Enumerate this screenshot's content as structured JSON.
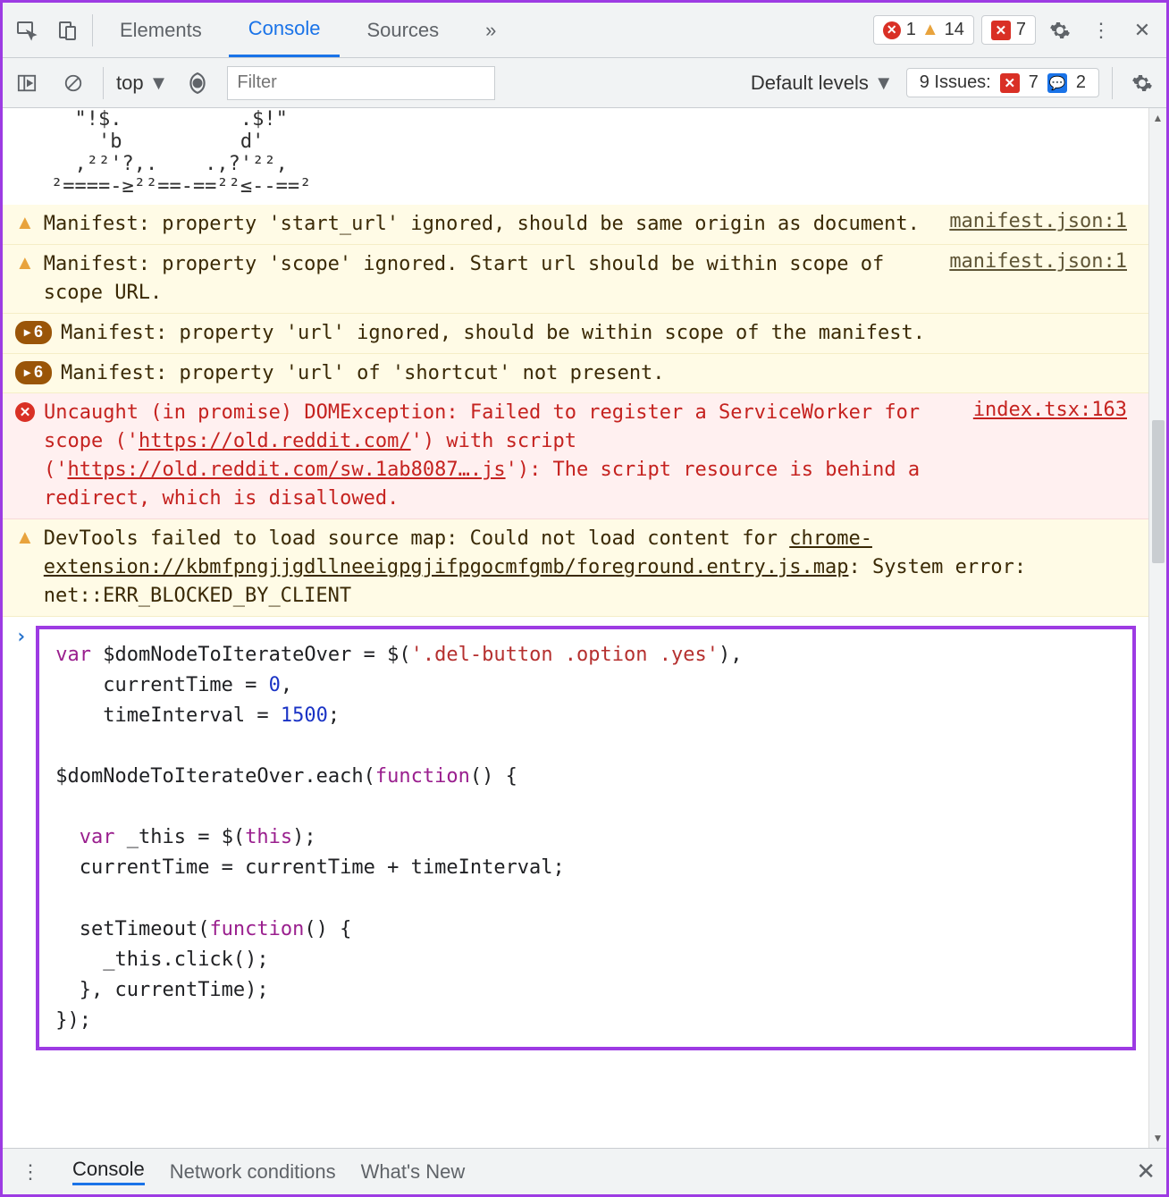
{
  "tabs": {
    "elements": "Elements",
    "console": "Console",
    "sources": "Sources"
  },
  "topStatus": {
    "errors": "1",
    "warnings": "14",
    "chat": "7"
  },
  "toolbar": {
    "context": "top",
    "filterPlaceholder": "Filter",
    "levelsLabel": "Default levels",
    "issuesLabel": "9 Issues:",
    "issuesRed": "7",
    "issuesBlue": "2"
  },
  "ascii": "  \"!$.          .$!\"\n    'b          d'\n  ,²²'?,.    .,?'²²,\n²====-≥²²==-==²²≤--==²",
  "messages": [
    {
      "type": "warn",
      "text": "Manifest: property 'start_url' ignored, should be same origin as document.",
      "link": "manifest.json:1"
    },
    {
      "type": "warn",
      "text": "Manifest: property 'scope' ignored. Start url should be within scope of scope URL.",
      "link": "manifest.json:1"
    },
    {
      "type": "warn-count",
      "count": "6",
      "text": "Manifest: property 'url' ignored, should be within scope of the manifest."
    },
    {
      "type": "warn-count",
      "count": "6",
      "text": "Manifest: property 'url' of 'shortcut' not present."
    },
    {
      "type": "err",
      "pre": "Uncaught (in promise) DOMException: Failed to register a ServiceWorker for scope ('",
      "url1": "https://old.reddit.com/",
      "mid": "') with script ('",
      "url2": "https://old.reddit.com/sw.1ab8087….js",
      "post": "'): The script resource is behind a redirect, which is disallowed.",
      "link": "index.tsx:163"
    },
    {
      "type": "warn",
      "pre": "DevTools failed to load source map: Could not load content for ",
      "url1": "chrome-extension://kbmfpngjjgdllneeigpgjifpgocmfgmb/foreground.entry.js.map",
      "post": ": System error: net::ERR_BLOCKED_BY_CLIENT"
    }
  ],
  "code": {
    "l1a": "var",
    "l1b": " $domNodeToIterateOver = $(",
    "l1c": "'.del-button .option .yes'",
    "l1d": "),",
    "l2a": "    currentTime = ",
    "l2b": "0",
    "l2c": ",",
    "l3a": "    timeInterval = ",
    "l3b": "1500",
    "l3c": ";",
    "l4": "",
    "l5a": "$domNodeToIterateOver.each(",
    "l5b": "function",
    "l5c": "() {",
    "l6": "",
    "l7a": "  var",
    "l7b": " _this = $(",
    "l7c": "this",
    "l7d": ");",
    "l8": "  currentTime = currentTime + timeInterval;",
    "l9": "",
    "l10a": "  setTimeout(",
    "l10b": "function",
    "l10c": "() {",
    "l11": "    _this.click();",
    "l12": "  }, currentTime);",
    "l13": "});"
  },
  "drawer": {
    "console": "Console",
    "netcond": "Network conditions",
    "whatsnew": "What's New"
  }
}
